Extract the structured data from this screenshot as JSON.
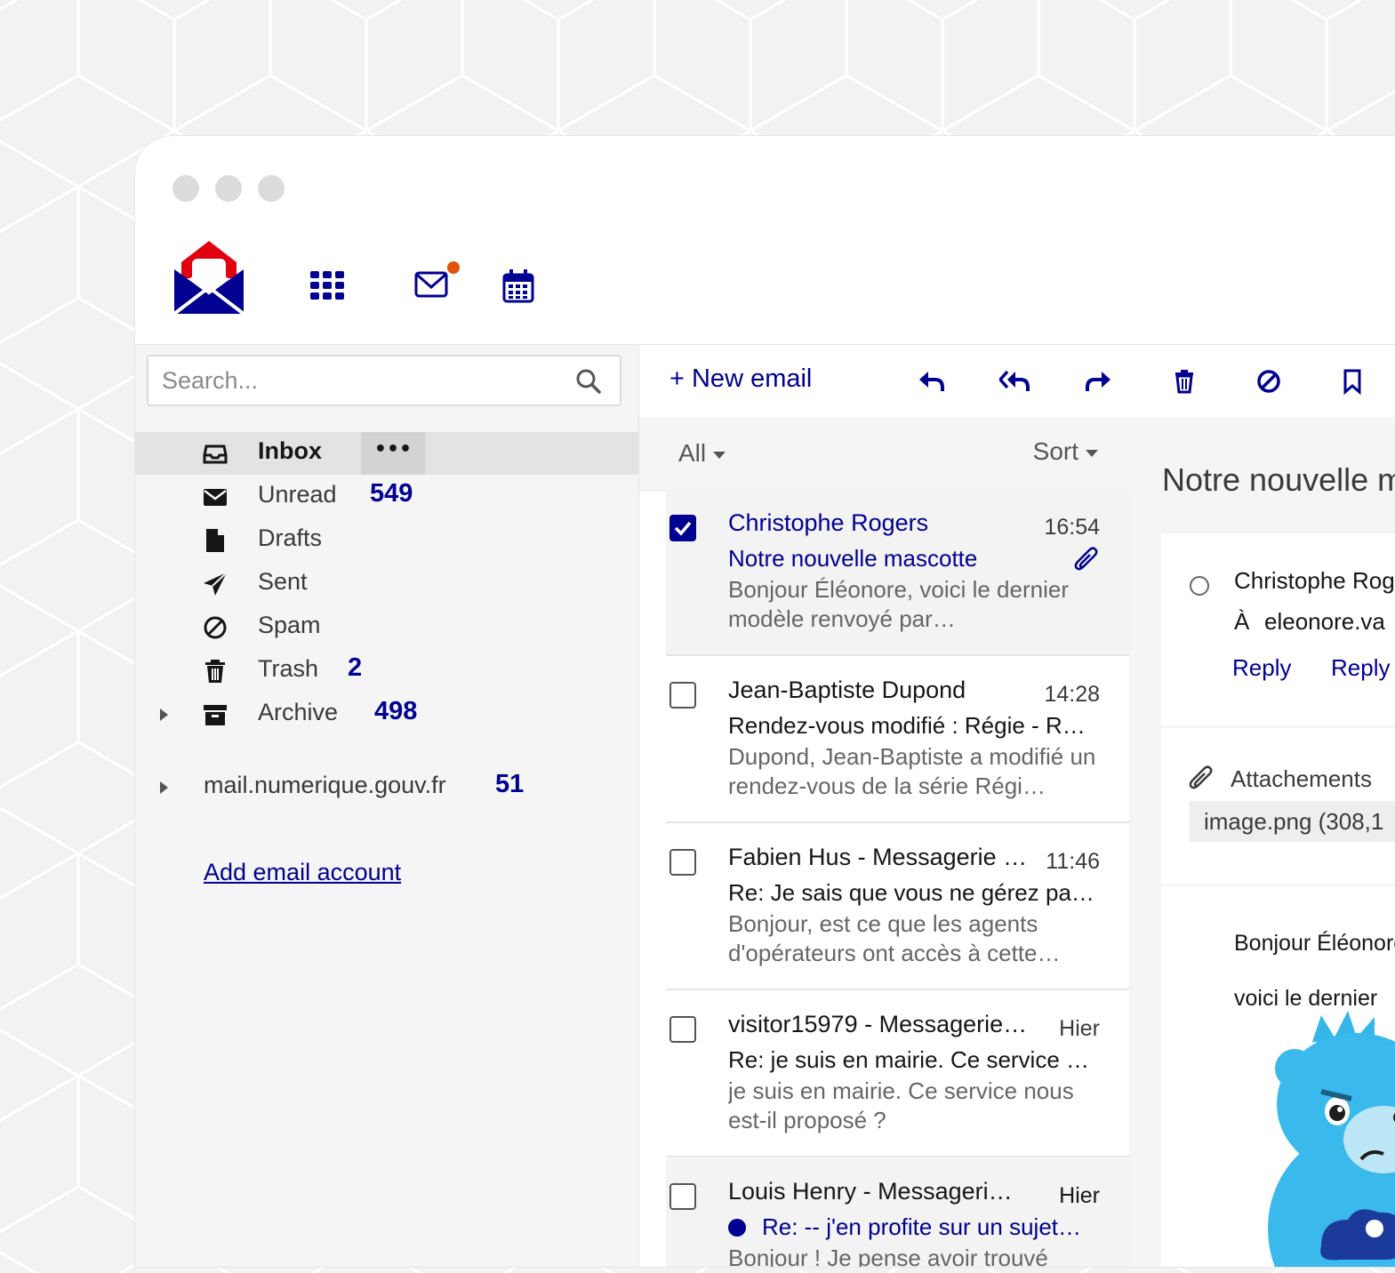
{
  "app": {
    "brand_colors": {
      "primary": "#000091",
      "accent": "#e1000f",
      "notification": "#e1530a"
    }
  },
  "topbar": {
    "icons": [
      "app-logo",
      "apps-grid-icon",
      "mail-icon",
      "calendar-icon"
    ]
  },
  "search": {
    "placeholder": "Search..."
  },
  "sidebar": {
    "folders": [
      {
        "label": "Inbox",
        "count": "",
        "icon": "inbox-icon",
        "more": "•••"
      },
      {
        "label": "Unread",
        "count": "549",
        "icon": "envelope-icon"
      },
      {
        "label": "Drafts",
        "count": "",
        "icon": "file-icon"
      },
      {
        "label": "Sent",
        "count": "",
        "icon": "paper-plane-icon"
      },
      {
        "label": "Spam",
        "count": "",
        "icon": "block-icon"
      },
      {
        "label": "Trash",
        "count": "2",
        "icon": "trash-icon"
      },
      {
        "label": "Archive",
        "count": "498",
        "icon": "archive-icon"
      }
    ],
    "account": {
      "label": "mail.numerique.gouv.fr",
      "count": "51"
    },
    "add_account": "Add email account"
  },
  "toolbar": {
    "new_email": "+ New email",
    "actions": [
      "reply-icon",
      "reply-all-icon",
      "forward-icon",
      "trash-icon",
      "spam-icon",
      "bookmark-icon"
    ]
  },
  "list": {
    "filter": "All",
    "sort": "Sort",
    "messages": [
      {
        "sender": "Christophe Rogers",
        "time": "16:54",
        "subject": "Notre nouvelle mascotte",
        "preview": "Bonjour Éléonore, voici le dernier modèle renvoyé par…",
        "selected": true,
        "attachment": true
      },
      {
        "sender": "Jean-Baptiste  Dupond",
        "time": "14:28",
        "subject": "Rendez-vous modifié : Régie - R…",
        "preview": "Dupond, Jean-Baptiste a modifié un rendez-vous de la série Régi…"
      },
      {
        "sender": "Fabien Hus - Messagerie …",
        "time": "11:46",
        "subject": "Re: Je sais que vous ne gérez pa…",
        "preview": "Bonjour, est ce que les agents d'opérateurs ont accès à cette…"
      },
      {
        "sender": "visitor15979 - Messagerie …",
        "time": "Hier",
        "subject": "Re: je suis en mairie. Ce service …",
        "preview": "je suis en mairie. Ce service nous est-il proposé ?"
      },
      {
        "sender": "Louis  Henry   - Messageri…",
        "time": "Hier",
        "subject": "Re: -- j'en profite sur un sujet…",
        "preview": "Bonjour ! Je pense avoir trouvé",
        "unread": true
      }
    ]
  },
  "reading": {
    "title": "Notre nouvelle mascotte",
    "from": "Christophe Rogers",
    "to_prefix": "À",
    "to": "eleonore.va",
    "reply": "Reply",
    "reply_all": "Reply",
    "attachments_label": "Attachements",
    "attachment_file": "image.png (308,1",
    "body_line1": "Bonjour Éléonore,",
    "body_line2": "voici le dernier"
  }
}
